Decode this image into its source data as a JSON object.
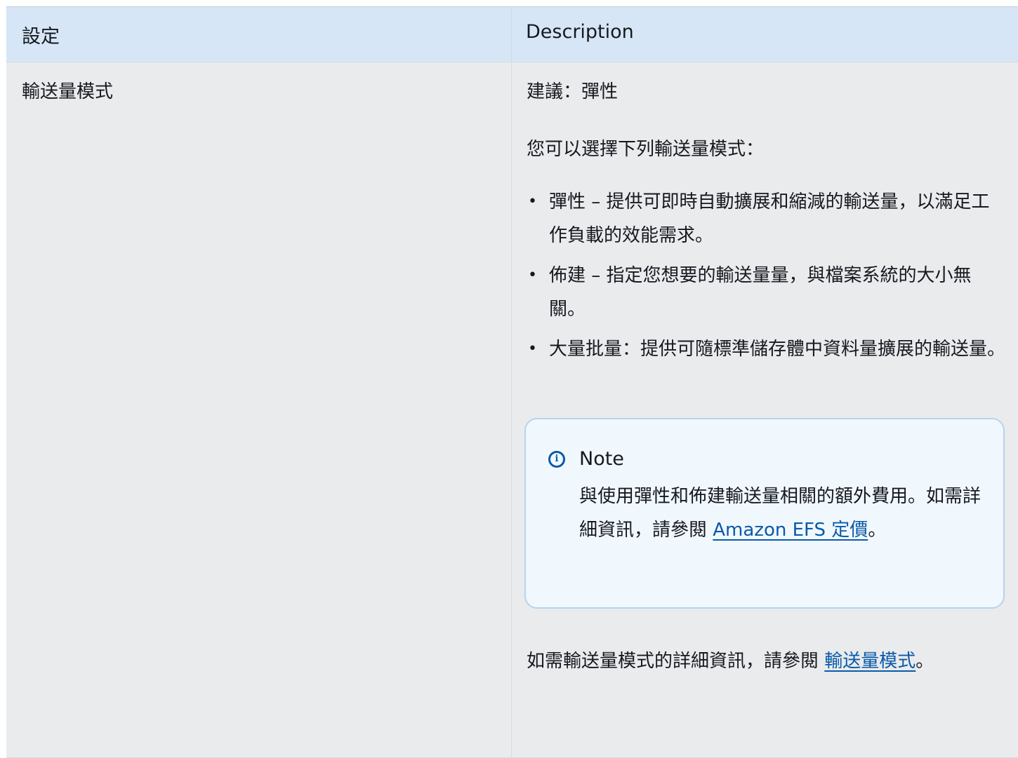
{
  "table": {
    "headers": [
      "設定",
      "Description"
    ],
    "row": {
      "setting": "輸送量模式",
      "recommendation": "建議：彈性",
      "intro": "您可以選擇下列輸送量模式：",
      "bullet_glyph": "•",
      "items": [
        "彈性 – 提供可即時自動擴展和縮減的輸送量，以滿足工作負載的效能需求。",
        "佈建 – 指定您想要的輸送量量，與檔案系統的大小無關。",
        "大量批量：提供可隨標準儲存體中資料量擴展的輸送量。"
      ],
      "note": {
        "icon": "info-icon",
        "icon_glyph": "i",
        "title": "Note",
        "text": "與使用彈性和佈建輸送量相關的額外費用。如需詳細資訊，請參閱 ",
        "link_text": "Amazon EFS 定價",
        "after_link": "。"
      },
      "more_text": "如需輸送量模式的詳細資訊，請參閱 ",
      "more_link_text": "輸送量模式",
      "more_after": "。"
    }
  },
  "colors": {
    "header_bg": "#d6e6f6",
    "body_bg": "#e9ebed",
    "note_bg": "#f1f8fd",
    "note_border": "#b8d3ea",
    "link": "#0a5aa8"
  }
}
